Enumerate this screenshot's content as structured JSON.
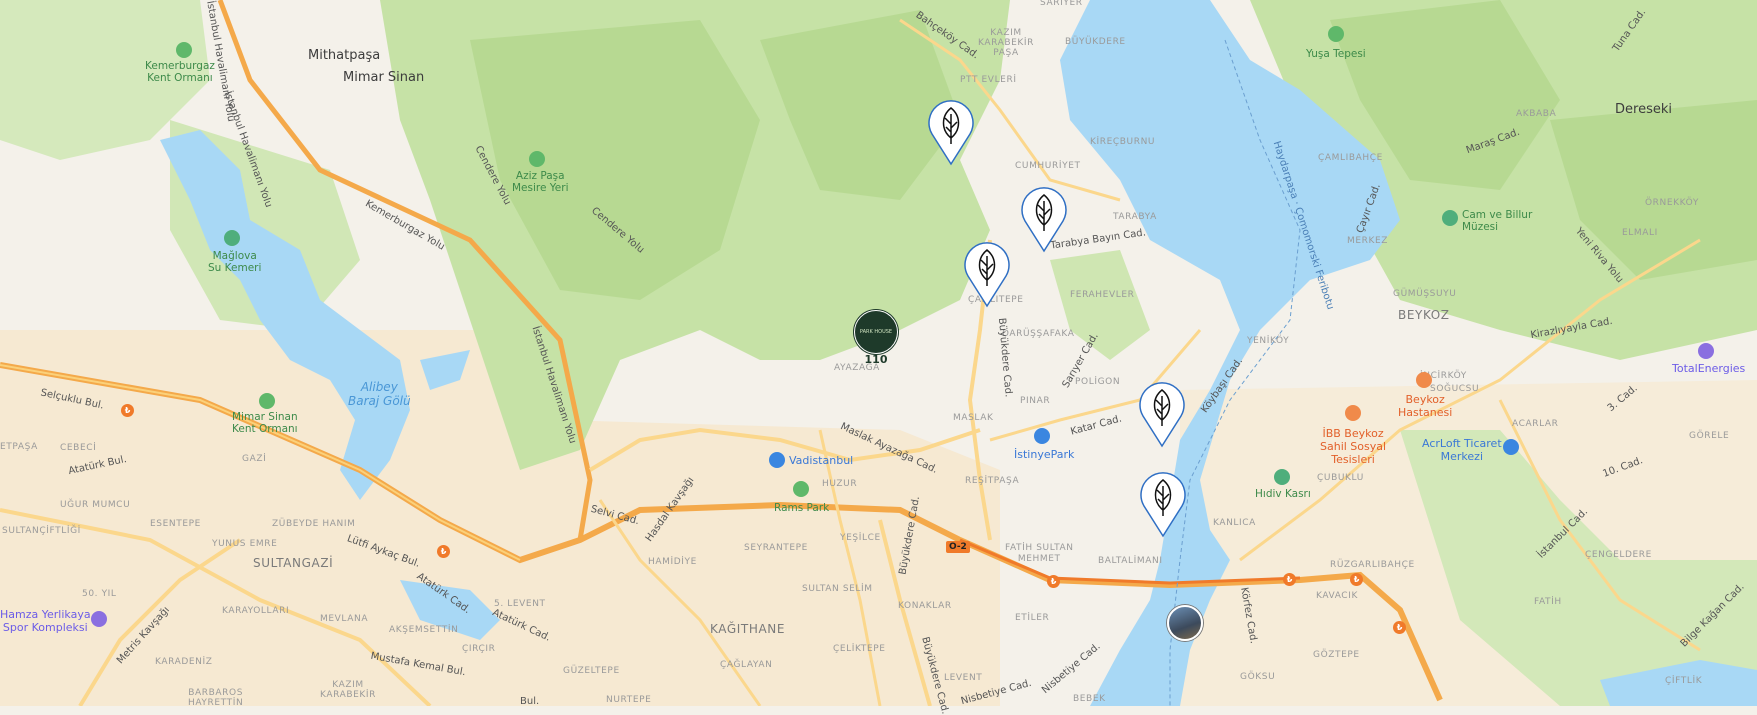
{
  "labels": {
    "sariyer": "SARIYER",
    "mithatpasa": "Mithatpaşa",
    "mimar_sinan": "Mimar Sinan",
    "dereseki": "Dereseki",
    "beykoz": "BEYKOZ",
    "sultangazi": "SULTANGAZİ",
    "kagithane": "KAĞITHANE",
    "kazim_karabekir_pasa_north": "KAZIM\nKARABEKİR\nPAŞA",
    "buyukdere": "BÜYÜKDERE",
    "ptt_evleri": "PTT EVLERİ",
    "kirecburnu": "KİREÇBURNU",
    "cumhuriyet": "CUMHURİYET",
    "tarabya": "TARABYA",
    "camlitepe": "ÇAMLITEPE",
    "ferahevler": "FERAHEVLER",
    "darussafaka": "DARÜŞŞAFAKA",
    "poligon": "POLİGON",
    "yenikoy": "YENİKÖY",
    "pinar": "PINAR",
    "maslak": "MASLAK",
    "ayazaga": "AYAZAĞA",
    "resitpasa": "REŞİTPAŞA",
    "huzur": "HUZUR",
    "fatih_sultan_mehmet": "FATİH SULTAN\nMEHMET",
    "baltalimani": "BALTALİMANI",
    "kanlica": "KANLICA",
    "etiler": "ETİLER",
    "levent": "LEVENT",
    "bebek": "BEBEK",
    "goksu": "GÖKSU",
    "seyrantepe": "SEYRANTEPE",
    "hamidiye": "HAMİDİYE",
    "yesilce": "YEŞİLCE",
    "sultan_selim": "SULTAN SELİM",
    "konaklar": "KONAKLAR",
    "celiktepe": "ÇELİKTEPE",
    "caglayan": "ÇAĞLAYAN",
    "nurtepe": "NURTEPE",
    "guzeltepe": "GÜZELTEPE",
    "esentepe": "ESENTEPE",
    "zubeyde_hanim": "ZÜBEYDE HANIM",
    "yunus_emre": "YUNUS EMRE",
    "ugur_mumcu": "UĞUR MUMCU",
    "cebeci": "CEBECİ",
    "gazi": "GAZİ",
    "sultanciftligi": "SULTANÇİFTLİĞİ",
    "tepasa": "ETPAŞA",
    "elli_yil": "50. YIL",
    "karayollari": "KARAYOLLARI",
    "mevlana": "MEVLANA",
    "aksemsettin": "AKŞEMSETTİN",
    "cirgir": "ÇIRÇIR",
    "bes_levent": "5. LEVENT",
    "karadeniz": "KARADENİZ",
    "kazim_karabekir_south": "KAZIM\nKARABEKİR",
    "barbaros_hayrettin": "BARBAROS\nHAYRETTİN",
    "camlibahce": "ÇAMLIBAHÇE",
    "merkez": "MERKEZ",
    "gumussuyu": "GÜMÜŞSUYU",
    "incirkoy": "İNCİRKÖY",
    "sogucsu": "SOĞUCSU",
    "acarlar": "ACARLAR",
    "cubuklu": "ÇUBUKLU",
    "rüzgarlibahce": "RÜZGARLIBAHÇE",
    "kavacik": "KAVACIK",
    "goztepe": "GÖZTEPE",
    "fatih_east": "FATİH",
    "cengeldere": "ÇENGELDERE",
    "gorele": "GÖRELE",
    "ornekkoy": "ÖRNEKKÖY",
    "elmali": "ELMALI",
    "akbaba": "AKBABA",
    "ciftlik": "ÇİFTLİK"
  },
  "roads": {
    "bahcekoy": "Bahçeköy Cad.",
    "istanbul_havalimani_1": "İstanbul Havalimanı Yolu",
    "istanbul_havalimani_2": "İstanbul Havalimanı Yolu",
    "istanbul_havalimani_3": "İstanbul Havalimanı Yolu",
    "kemerburgaz": "Kemerburgaz Yolu",
    "cendere_1": "Cendere Yolu",
    "cendere_2": "Cendere Yolu",
    "tarabya_bayin": "Tarabya Bayın Cad.",
    "buyukdere_1": "Büyükdere Cad.",
    "buyukdere_2": "Büyükdere Cad.",
    "buyukdere_3": "Büyükdere Cad.",
    "sariyer_cad": "Sarıyer Cad.",
    "katar": "Katar Cad.",
    "koybasi": "Köybaşı Cad.",
    "maslak_ayazaga": "Maslak Ayazağa Cad.",
    "selvi": "Selvi Cad.",
    "hasdal": "Hasdal Kavşağı",
    "lutfi_aykac": "Lütfi Aykaç Bul.",
    "ataturk_1": "Atatürk Bul.",
    "ataturk_2": "Atatürk Cad.",
    "ataturk_3": "Atatürk Cad.",
    "metris": "Metris Kavşağı",
    "mustafa_kemal": "Mustafa Kemal Bul.",
    "selcuklu": "Selçuklu Bul.",
    "nisbetiye_1": "Nisbetiye Cad.",
    "nisbetiye_2": "Nisbetiye Cad.",
    "korfez": "Körfez Cad.",
    "ferry": "Haydarpaşa · Çomomorski Feribotu",
    "cayir": "Çayır Cad.",
    "maras": "Maraş Cad.",
    "yeni_riva": "Yeni Riva Yolu",
    "kirazlıyayla": "Kirazlıyayla Cad.",
    "uc_cad": "3. Cad.",
    "on_cad": "10. Cad.",
    "istanbul_cad": "İstanbul Cad.",
    "bilge_kagan": "Bilge Kağan Cad.",
    "tuna": "Tuna Cad.",
    "eski_bul": "Bul.",
    "hwy_o2": "O-2"
  },
  "pois": {
    "kemerburgaz_kent_ormani": "Kemerburgaz\nKent Ormanı",
    "aziz_pasa": "Aziz Paşa\nMesire Yeri",
    "maglova": "Mağlova\nSu Kemeri",
    "mimar_sinan_kent_ormani": "Mimar Sinan\nKent Ormanı",
    "alibey_baraj": "Alibey\nBaraj Gölü",
    "vadistanbul": "Vadistanbul",
    "rams_park": "Rams Park",
    "istinyepark": "İstinyePark",
    "yusa_tepesi": "Yuşa Tepesi",
    "cam_ve_billur": "Cam ve Billur\nMüzesi",
    "beykoz_hastanesi": "Beykoz\nHastanesi",
    "ibb_beykoz": "İBB Beykoz\nSahil Sosyal\nTesisleri",
    "hidiv_kasri": "Hıdiv Kasrı",
    "acrloft": "AcrLoft Ticaret\nMerkezi",
    "totalenergies": "TotalEnergies",
    "hamza_yerlikaya": "Hamza Yerlikaya\nSpor Kompleksi"
  },
  "markers": {
    "park_house_name": "PARK HOUSE",
    "park_house_count": "110",
    "leaf_pins": [
      "leaf-pin-1",
      "leaf-pin-2",
      "leaf-pin-3",
      "leaf-pin-4",
      "leaf-pin-5"
    ]
  },
  "colors": {
    "land": "#f4f1ea",
    "forest": "#c6e2a6",
    "forest_dark": "#b3d68e",
    "water": "#a8d8f5",
    "highway": "#f4a94a",
    "road": "#fbd78c",
    "urban": "#f5e8d3",
    "pin_stroke": "#2f6fc4",
    "park_house_bg": "#1e3a2a"
  }
}
